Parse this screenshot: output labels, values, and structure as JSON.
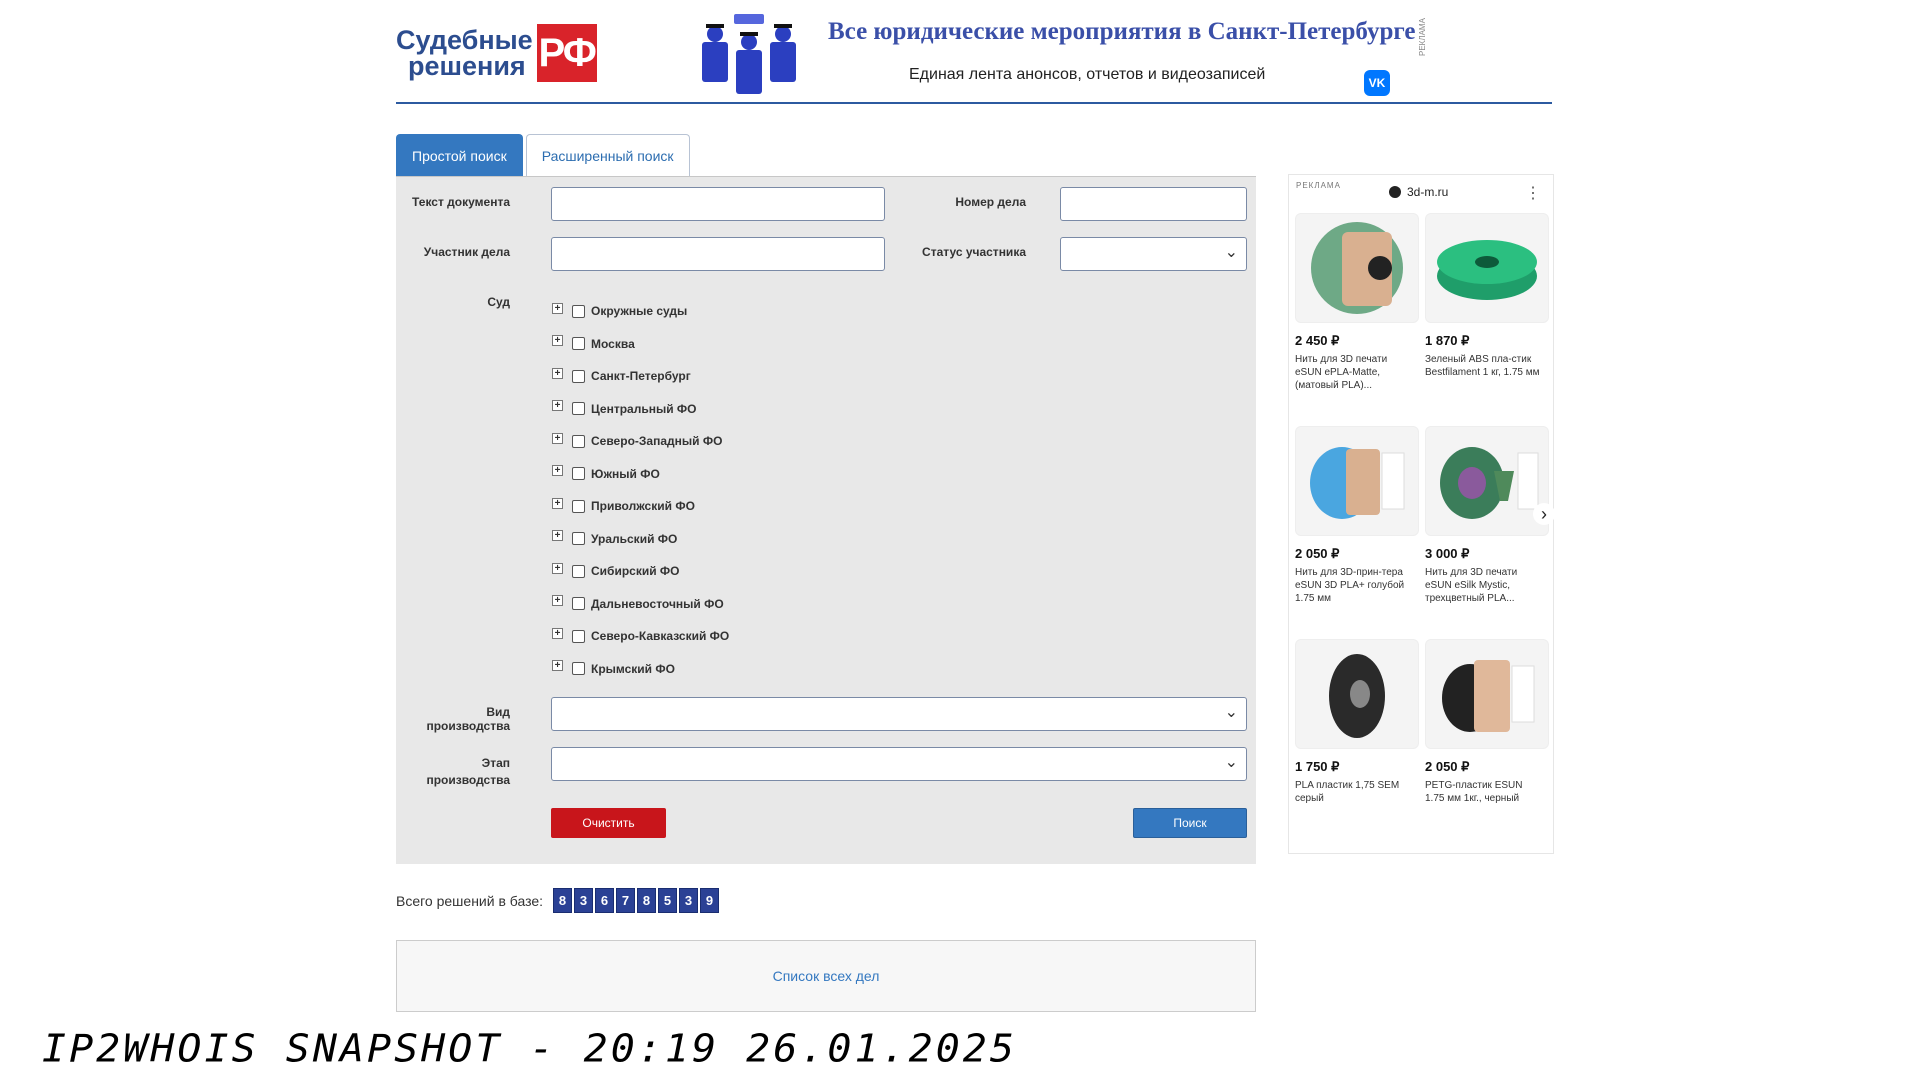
{
  "header": {
    "logo_line1": "Судебные",
    "logo_line2": "решения",
    "logo_badge": "РФ",
    "banner_title": "Все юридические мероприятия в Санкт-Петербурге",
    "banner_subtitle": "Единая лента анонсов, отчетов и видеозаписей",
    "vk_label": "VK",
    "ad_label": "РЕКЛАМА"
  },
  "tabs": [
    {
      "label": "Простой поиск",
      "active": true
    },
    {
      "label": "Расширенный поиск",
      "active": false
    }
  ],
  "form": {
    "doc_text_label": "Текст документа",
    "case_number_label": "Номер дела",
    "participant_label": "Участник дела",
    "participant_status_label": "Статус участника",
    "court_label": "Суд",
    "courts": [
      "Окружные суды",
      "Москва",
      "Санкт-Петербург",
      "Центральный ФО",
      "Северо-Западный ФО",
      "Южный ФО",
      "Приволжский ФО",
      "Уральский ФО",
      "Сибирский ФО",
      "Дальневосточный ФО",
      "Северо-Кавказский ФО",
      "Крымский ФО"
    ],
    "proceeding_type_label": "Вид производства",
    "stage_label_1": "Этап",
    "stage_label_2": "производства",
    "clear_button": "Очистить",
    "search_button": "Поиск"
  },
  "counter": {
    "label": "Всего решений в базе:",
    "digits": [
      "8",
      "3",
      "6",
      "7",
      "8",
      "5",
      "3",
      "9"
    ]
  },
  "all_cases_link": "Список всех дел",
  "ad": {
    "label": "РЕКЛАМА",
    "domain": "3d-m.ru",
    "products": [
      {
        "price": "2 450 ₽",
        "title": "Нить для 3D печати eSUN ePLA-Matte, (матовый PLA)..."
      },
      {
        "price": "1 870 ₽",
        "title": "Зеленый ABS пла-стик Bestfilament 1 кг, 1.75 мм"
      },
      {
        "price": "2 050 ₽",
        "title": "Нить для 3D-прин-тера eSUN 3D PLA+ голубой 1.75 мм"
      },
      {
        "price": "3 000 ₽",
        "title": "Нить для 3D печати eSUN eSilk Mystic, трехцветный PLA..."
      },
      {
        "price": "1 750 ₽",
        "title": "PLA пластик 1,75 SEM серый"
      },
      {
        "price": "2 050 ₽",
        "title": "PETG-пластик ESUN 1.75 мм 1кг., черный"
      }
    ]
  },
  "watermark": "IP2WHOIS SNAPSHOT - 20:19 26.01.2025"
}
